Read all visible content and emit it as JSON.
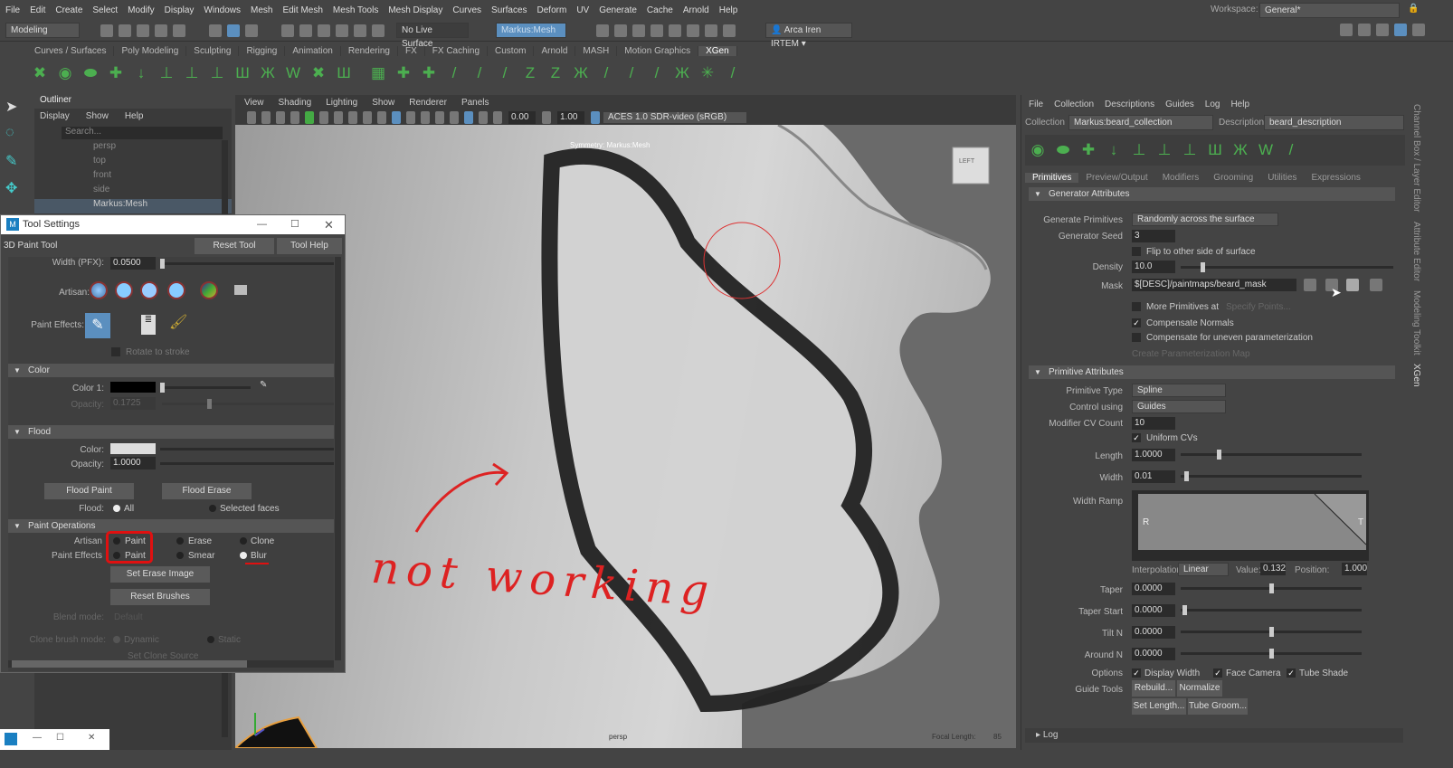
{
  "menubar": [
    "File",
    "Edit",
    "Create",
    "Select",
    "Modify",
    "Display",
    "Windows",
    "Mesh",
    "Edit Mesh",
    "Mesh Tools",
    "Mesh Display",
    "Curves",
    "Surfaces",
    "Deform",
    "UV",
    "Generate",
    "Cache",
    "Arnold",
    "Help"
  ],
  "workspace": {
    "label": "Workspace:",
    "value": "General*"
  },
  "status": {
    "mode": "Modeling",
    "live_surface": "No Live Surface",
    "object": "Markus:Mesh",
    "user": "Arca Iren IRTEM"
  },
  "shelf_tabs": [
    "Curves / Surfaces",
    "Poly Modeling",
    "Sculpting",
    "Rigging",
    "Animation",
    "Rendering",
    "FX",
    "FX Caching",
    "Custom",
    "Arnold",
    "MASH",
    "Motion Graphics",
    "XGen"
  ],
  "outliner": {
    "title": "Outliner",
    "menu": [
      "Display",
      "Show",
      "Help"
    ],
    "search_placeholder": "Search...",
    "items": [
      "persp",
      "top",
      "front",
      "side",
      "Markus:Mesh"
    ]
  },
  "viewport": {
    "menu": [
      "View",
      "Shading",
      "Lighting",
      "Show",
      "Renderer",
      "Panels"
    ],
    "exposure": "0.00",
    "gamma": "1.00",
    "color_space": "ACES 1.0 SDR-video (sRGB)",
    "symmetry": "Symmetry: Markus:Mesh",
    "view_cube": "LEFT",
    "camera": "persp",
    "focal_label": "Focal Length:",
    "focal_value": "85",
    "annotation": "not working"
  },
  "tool_settings": {
    "window_title": "Tool Settings",
    "tool_name": "3D Paint Tool",
    "reset": "Reset Tool",
    "help": "Tool Help",
    "width_label": "Width (PFX):",
    "width_value": "0.0500",
    "artisan_label": "Artisan:",
    "paint_effects_label": "Paint Effects:",
    "rotate_label": "Rotate to stroke",
    "color_section": "Color",
    "color1_label": "Color 1:",
    "opacity_label": "Opacity:",
    "opacity_value": "0.1725",
    "flood_section": "Flood",
    "flood_color_label": "Color:",
    "flood_opacity_label": "Opacity:",
    "flood_opacity_value": "1.0000",
    "flood_paint": "Flood Paint",
    "flood_erase": "Flood Erase",
    "flood_label": "Flood:",
    "flood_all": "All",
    "flood_selected": "Selected faces",
    "paint_ops_section": "Paint Operations",
    "artisan_ops_label": "Artisan",
    "pfx_ops_label": "Paint Effects",
    "ops_artisan": [
      "Paint",
      "Erase",
      "Clone"
    ],
    "ops_pfx": [
      "Paint",
      "Smear",
      "Blur"
    ],
    "set_erase": "Set Erase Image",
    "reset_brushes": "Reset Brushes",
    "blend_label": "Blend mode:",
    "blend_value": "Default",
    "clone_label": "Clone brush mode:",
    "clone_dynamic": "Dynamic",
    "clone_static": "Static",
    "clone_source": "Set Clone Source"
  },
  "xgen": {
    "menu": [
      "File",
      "Collection",
      "Descriptions",
      "Guides",
      "Log",
      "Help"
    ],
    "collection_label": "Collection",
    "collection": "Markus:beard_collection",
    "description_label": "Description",
    "description": "beard_description",
    "tabs": [
      "Primitives",
      "Preview/Output",
      "Modifiers",
      "Grooming",
      "Utilities",
      "Expressions"
    ],
    "generator_section": "Generator Attributes",
    "gen_prim_label": "Generate Primitives",
    "gen_prim": "Randomly across the surface",
    "seed_label": "Generator Seed",
    "seed": "3",
    "flip": "Flip to other side of surface",
    "density_label": "Density",
    "density": "10.0",
    "mask_label": "Mask",
    "mask": "$[DESC]/paintmaps/beard_mask",
    "more_prims": "More Primitives at",
    "specify_points": "Specify Points...",
    "comp_normals": "Compensate Normals",
    "comp_param": "Compensate for uneven parameterization",
    "create_param": "Create Parameterization Map",
    "primitive_section": "Primitive Attributes",
    "prim_type_label": "Primitive Type",
    "prim_type": "Spline",
    "control_label": "Control using",
    "control": "Guides",
    "cv_label": "Modifier CV Count",
    "cv": "10",
    "uniform_cvs": "Uniform CVs",
    "length_label": "Length",
    "length": "1.0000",
    "width_label": "Width",
    "width": "0.01",
    "ramp_label": "Width Ramp",
    "ramp_r": "R",
    "ramp_t": "T",
    "interp_label": "Interpolation:",
    "interp": "Linear",
    "value_label": "Value:",
    "value": "0.132",
    "position_label": "Position:",
    "position": "1.000",
    "taper_label": "Taper",
    "taper": "0.0000",
    "taper_start_label": "Taper Start",
    "taper_start": "0.0000",
    "tilt_label": "Tilt N",
    "tilt": "0.0000",
    "around_label": "Around N",
    "around": "0.0000",
    "options_label": "Options",
    "opt_display_width": "Display Width",
    "opt_face_camera": "Face Camera",
    "opt_tube_shade": "Tube Shade",
    "guide_tools_label": "Guide Tools",
    "rebuild": "Rebuild...",
    "normalize": "Normalize",
    "set_length": "Set Length...",
    "tube_groom": "Tube Groom...",
    "log": "Log"
  },
  "side_tabs": [
    "Channel Box / Layer Editor",
    "Attribute Editor",
    "Modeling Toolkit",
    "XGen"
  ]
}
